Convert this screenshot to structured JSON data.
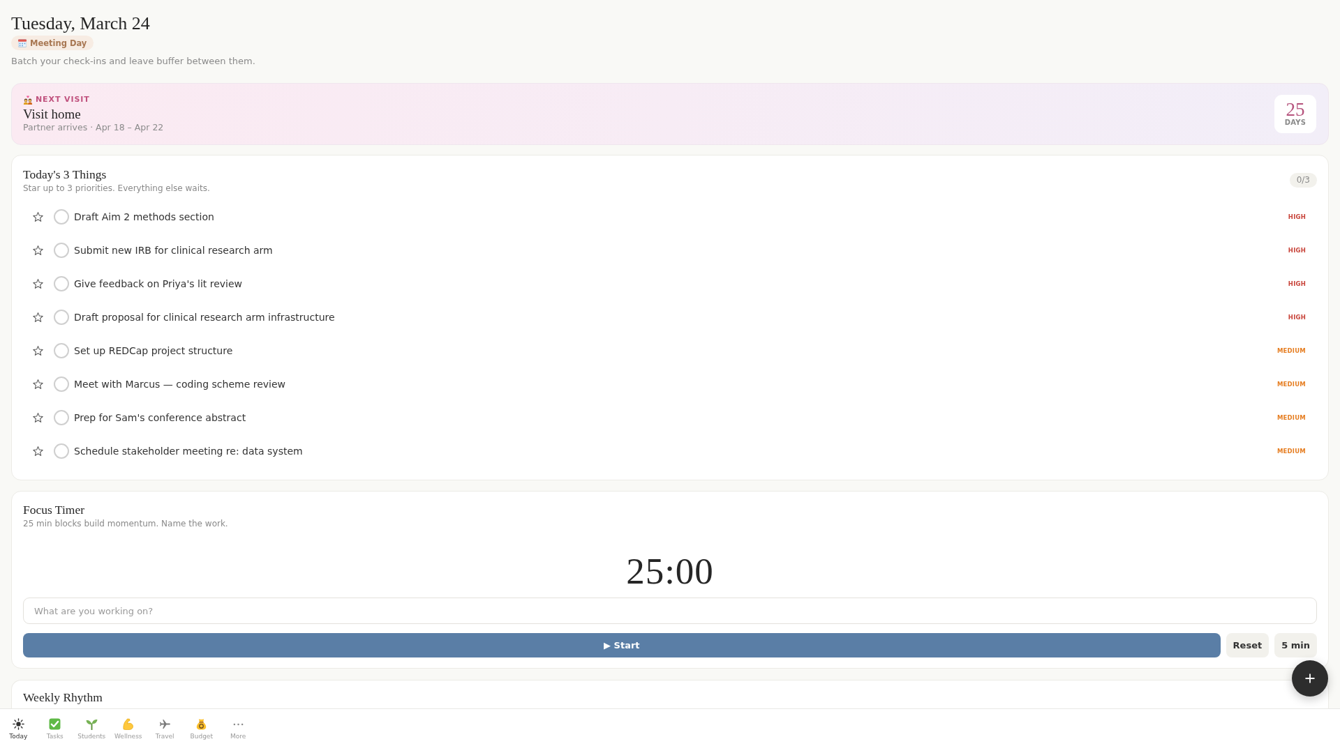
{
  "header": {
    "title": "Tuesday, March 24",
    "day_badge": "Meeting Day",
    "tip": "Batch your check-ins and leave buffer between them."
  },
  "next_visit": {
    "label": "NEXT VISIT",
    "title": "Visit home",
    "detail": "Partner arrives · Apr 18 – Apr 22",
    "countdown": "25",
    "countdown_unit": "DAYS"
  },
  "priorities": {
    "title": "Today's 3 Things",
    "subtitle": "Star up to 3 priorities. Everything else waits.",
    "count": "0/3",
    "tasks": [
      {
        "text": "Draft Aim 2 methods section",
        "starred": false,
        "done": false,
        "priority": "HIGH",
        "color": "#c8443a"
      },
      {
        "text": "Submit new IRB for clinical research arm",
        "starred": false,
        "done": false,
        "priority": "HIGH",
        "color": "#c8443a"
      },
      {
        "text": "Give feedback on Priya's lit review",
        "starred": false,
        "done": false,
        "priority": "HIGH",
        "color": "#c8443a"
      },
      {
        "text": "Draft proposal for clinical research arm infrastructure",
        "starred": false,
        "done": false,
        "priority": "HIGH",
        "color": "#c8443a"
      },
      {
        "text": "Set up REDCap project structure",
        "starred": false,
        "done": false,
        "priority": "MEDIUM",
        "color": "#e67e22"
      },
      {
        "text": "Meet with Marcus — coding scheme review",
        "starred": false,
        "done": false,
        "priority": "MEDIUM",
        "color": "#e67e22"
      },
      {
        "text": "Prep for Sam's conference abstract",
        "starred": false,
        "done": false,
        "priority": "MEDIUM",
        "color": "#e67e22"
      },
      {
        "text": "Schedule stakeholder meeting re: data system",
        "starred": false,
        "done": false,
        "priority": "MEDIUM",
        "color": "#e67e22"
      }
    ]
  },
  "focus_timer": {
    "title": "Focus Timer",
    "subtitle": "25 min blocks build momentum. Name the work.",
    "time": "25:00",
    "task_field": {
      "placeholder": "What are you working on?"
    },
    "buttons": [
      {
        "label": "▶ Start",
        "kind": "primary"
      },
      {
        "label": "Reset",
        "kind": "secondary"
      },
      {
        "label": "5 min",
        "kind": "secondary"
      }
    ]
  },
  "weekly_rhythm": {
    "title": "Weekly Rhythm"
  },
  "bottom_nav": {
    "items": [
      {
        "label": "Today",
        "kind": "today",
        "selected": true
      },
      {
        "label": "Tasks",
        "kind": "tasks",
        "selected": false
      },
      {
        "label": "Students",
        "kind": "students",
        "selected": false
      },
      {
        "label": "Wellness",
        "kind": "wellness",
        "selected": false
      },
      {
        "label": "Travel",
        "kind": "travel",
        "selected": false
      },
      {
        "label": "Budget",
        "kind": "budget",
        "selected": false
      },
      {
        "label": "More",
        "kind": "more",
        "selected": false
      }
    ]
  }
}
